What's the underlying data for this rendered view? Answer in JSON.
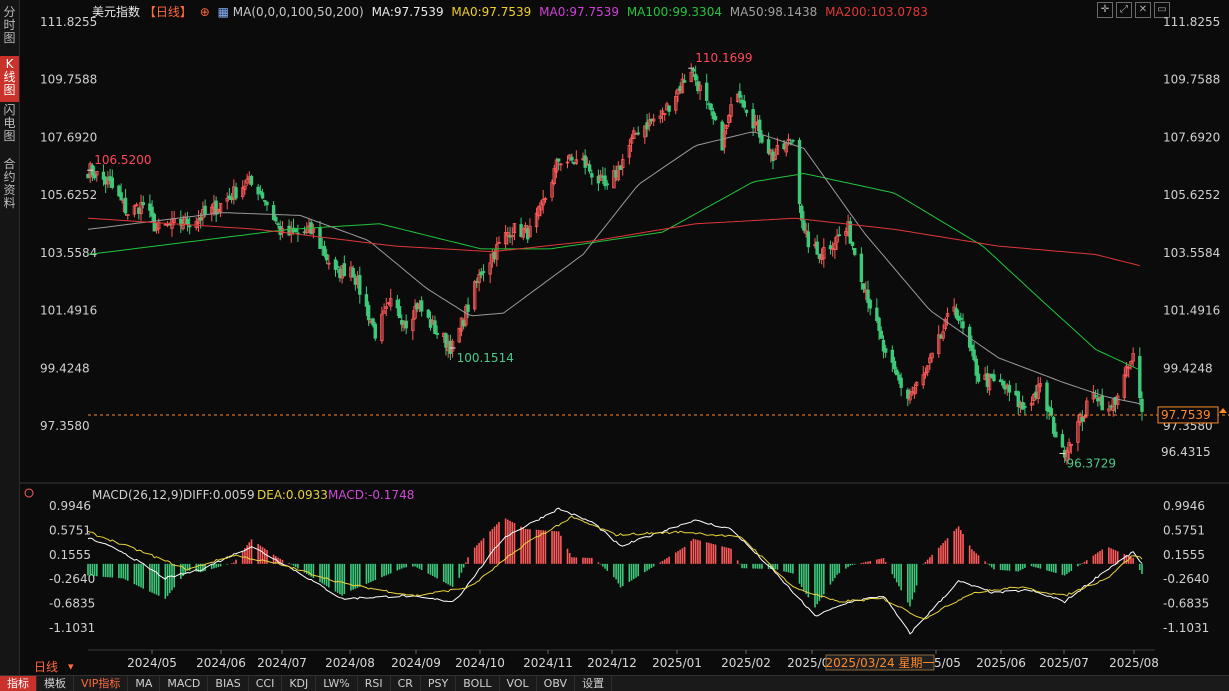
{
  "sidebar": {
    "tabs": [
      {
        "label": "分时图",
        "active": false
      },
      {
        "label": "K线图",
        "active": true
      },
      {
        "label": "闪电图",
        "active": false
      },
      {
        "label": "合约资料",
        "active": false
      }
    ]
  },
  "header": {
    "title": "美元指数",
    "period": "【日线】",
    "ma_params": "MA(0,0,0,100,50,200)",
    "ma_close": "MA:97.7539",
    "ma1": "MA0:97.7539",
    "ma2": "MA0:97.7539",
    "ma100": "MA100:99.3304",
    "ma50": "MA50:98.1438",
    "ma200": "MA200:103.0783",
    "icons": [
      "crosshair-icon",
      "expand-icon",
      "close-icon",
      "window-icon"
    ]
  },
  "colors": {
    "up": "#ff5a5a",
    "down": "#3ec97a",
    "ma50": "#9a9a9a",
    "ma100": "#22c53c",
    "ma200": "#e03838",
    "label_high": "#ff4a5a",
    "label_low": "#4ec98a",
    "price": "#ff8a2a",
    "dif": "#ffffff",
    "dea": "#e8d23c",
    "macd": "#d048d8"
  },
  "price_labels": {
    "y_ticks_text": [
      "111.8255",
      "109.7588",
      "107.6920",
      "105.6252",
      "103.5584",
      "101.4916",
      "99.4248",
      "97.3580"
    ],
    "current": "97.7539",
    "low_right": "96.4315",
    "annot_high1": "106.5200",
    "annot_high2": "110.1699",
    "annot_low1": "100.1514",
    "annot_low2": "96.3729"
  },
  "macd_header": {
    "params": "MACD(26,12,9)",
    "diff": "DIFF:0.0059",
    "dea": "DEA:0.0933",
    "macd": "MACD:-0.1748"
  },
  "macd_ticks_text": [
    "0.9946",
    "0.5751",
    "0.1555",
    "-0.2640",
    "-0.6835",
    "-1.1031"
  ],
  "x_labels": [
    "2024/05",
    "2024/06",
    "2024/07",
    "2024/08",
    "2024/09",
    "2024/10",
    "2024/11",
    "2024/12",
    "2025/01",
    "2025/02",
    "2025/03",
    "2025/05",
    "2025/06",
    "2025/07",
    "2025/08"
  ],
  "cursor_date": "2025/03/24 星期一",
  "period_label": "日线",
  "toolbar": [
    "指标",
    "模板",
    "VIP指标",
    "MA",
    "MACD",
    "BIAS",
    "CCI",
    "KDJ",
    "LW%",
    "RSI",
    "CR",
    "PSY",
    "BOLL",
    "VOL",
    "OBV",
    "设置"
  ],
  "chart_data": {
    "type": "candlestick",
    "title": "美元指数",
    "ylim": [
      96.0,
      112.0
    ],
    "x_range": [
      "2024-04-15",
      "2025-08-05"
    ],
    "anchors": [
      [
        "2024-04-16",
        106.52
      ],
      [
        "2024-04-25",
        106.0
      ],
      [
        "2024-05-03",
        105.0
      ],
      [
        "2024-05-10",
        105.3
      ],
      [
        "2024-05-16",
        104.4
      ],
      [
        "2024-05-31",
        104.7
      ],
      [
        "2024-06-07",
        104.9
      ],
      [
        "2024-06-14",
        105.3
      ],
      [
        "2024-06-26",
        106.1
      ],
      [
        "2024-07-02",
        105.8
      ],
      [
        "2024-07-12",
        104.2
      ],
      [
        "2024-07-26",
        104.3
      ],
      [
        "2024-08-05",
        102.8
      ],
      [
        "2024-08-12",
        103.1
      ],
      [
        "2024-08-23",
        100.7
      ],
      [
        "2024-08-30",
        101.7
      ],
      [
        "2024-09-06",
        101.1
      ],
      [
        "2024-09-11",
        101.7
      ],
      [
        "2024-09-20",
        100.7
      ],
      [
        "2024-09-27",
        100.15
      ],
      [
        "2024-10-10",
        102.9
      ],
      [
        "2024-10-23",
        104.4
      ],
      [
        "2024-11-01",
        104.3
      ],
      [
        "2024-11-06",
        105.1
      ],
      [
        "2024-11-14",
        106.9
      ],
      [
        "2024-11-25",
        106.8
      ],
      [
        "2024-12-06",
        105.8
      ],
      [
        "2024-12-20",
        108.0
      ],
      [
        "2024-12-31",
        108.5
      ],
      [
        "2025-01-13",
        110.17
      ],
      [
        "2025-01-27",
        107.5
      ],
      [
        "2025-02-03",
        109.5
      ],
      [
        "2025-02-10",
        108.3
      ],
      [
        "2025-02-19",
        107.0
      ],
      [
        "2025-02-28",
        107.6
      ],
      [
        "2025-03-05",
        104.2
      ],
      [
        "2025-03-11",
        103.5
      ],
      [
        "2025-03-25",
        104.4
      ],
      [
        "2025-04-03",
        102.0
      ],
      [
        "2025-04-11",
        99.8
      ],
      [
        "2025-04-21",
        98.4
      ],
      [
        "2025-04-29",
        99.2
      ],
      [
        "2025-05-12",
        101.7
      ],
      [
        "2025-05-23",
        99.1
      ],
      [
        "2025-06-03",
        98.8
      ],
      [
        "2025-06-12",
        98.0
      ],
      [
        "2025-06-20",
        98.7
      ],
      [
        "2025-06-30",
        96.37
      ],
      [
        "2025-07-15",
        98.6
      ],
      [
        "2025-07-21",
        97.8
      ],
      [
        "2025-08-01",
        99.8
      ],
      [
        "2025-08-05",
        97.75
      ]
    ],
    "series": [
      {
        "name": "MA100",
        "values": [
          [
            "2024-04-15",
            103.5
          ],
          [
            "2024-07-15",
            104.4
          ],
          [
            "2024-08-25",
            104.6
          ],
          [
            "2024-10-10",
            103.7
          ],
          [
            "2024-11-10",
            103.7
          ],
          [
            "2024-12-31",
            104.3
          ],
          [
            "2025-02-10",
            106.1
          ],
          [
            "2025-03-05",
            106.4
          ],
          [
            "2025-04-15",
            105.7
          ],
          [
            "2025-05-25",
            103.8
          ],
          [
            "2025-06-20",
            101.9
          ],
          [
            "2025-07-15",
            100.1
          ],
          [
            "2025-08-05",
            99.33
          ]
        ]
      },
      {
        "name": "MA50",
        "values": [
          [
            "2024-04-15",
            104.4
          ],
          [
            "2024-06-15",
            105.0
          ],
          [
            "2024-07-20",
            104.9
          ],
          [
            "2024-08-20",
            104.0
          ],
          [
            "2024-09-15",
            102.3
          ],
          [
            "2024-10-05",
            101.3
          ],
          [
            "2024-10-20",
            101.4
          ],
          [
            "2024-11-25",
            103.5
          ],
          [
            "2024-12-20",
            106.0
          ],
          [
            "2025-01-15",
            107.4
          ],
          [
            "2025-02-10",
            107.9
          ],
          [
            "2025-03-05",
            107.3
          ],
          [
            "2025-04-01",
            104.3
          ],
          [
            "2025-05-01",
            101.5
          ],
          [
            "2025-06-01",
            99.8
          ],
          [
            "2025-07-01",
            98.9
          ],
          [
            "2025-07-20",
            98.4
          ],
          [
            "2025-08-05",
            98.14
          ]
        ]
      },
      {
        "name": "MA200",
        "values": [
          [
            "2024-04-15",
            104.8
          ],
          [
            "2024-07-01",
            104.4
          ],
          [
            "2024-09-01",
            103.8
          ],
          [
            "2024-10-15",
            103.6
          ],
          [
            "2024-12-01",
            104.0
          ],
          [
            "2025-01-15",
            104.6
          ],
          [
            "2025-03-01",
            104.8
          ],
          [
            "2025-04-15",
            104.4
          ],
          [
            "2025-06-01",
            103.8
          ],
          [
            "2025-07-15",
            103.5
          ],
          [
            "2025-08-05",
            103.08
          ]
        ]
      }
    ],
    "annotations": [
      {
        "date": "2024-04-16",
        "value": 106.52,
        "text": "106.5200"
      },
      {
        "date": "2025-01-13",
        "value": 110.1699,
        "text": "110.1699"
      },
      {
        "date": "2024-09-27",
        "value": 100.1514,
        "text": "100.1514"
      },
      {
        "date": "2025-06-30",
        "value": 96.3729,
        "text": "96.3729"
      }
    ],
    "current_price": 97.7539,
    "macd": {
      "params": "26,12,9",
      "diff": 0.0059,
      "dea": 0.0933,
      "macd": -0.1748,
      "ylim": [
        -1.3,
        1.15
      ],
      "dif_anchors": [
        [
          "2024-04-15",
          0.45
        ],
        [
          "2024-05-01",
          0.2
        ],
        [
          "2024-05-20",
          -0.25
        ],
        [
          "2024-06-05",
          -0.1
        ],
        [
          "2024-06-28",
          0.3
        ],
        [
          "2024-07-15",
          -0.05
        ],
        [
          "2024-08-08",
          -0.6
        ],
        [
          "2024-09-05",
          -0.55
        ],
        [
          "2024-09-28",
          -0.65
        ],
        [
          "2024-10-20",
          0.45
        ],
        [
          "2024-11-14",
          0.95
        ],
        [
          "2024-11-30",
          0.7
        ],
        [
          "2024-12-12",
          0.3
        ],
        [
          "2025-01-14",
          0.75
        ],
        [
          "2025-01-31",
          0.6
        ],
        [
          "2025-02-20",
          -0.15
        ],
        [
          "2025-03-10",
          -0.9
        ],
        [
          "2025-03-26",
          -0.65
        ],
        [
          "2025-04-10",
          -0.55
        ],
        [
          "2025-04-22",
          -1.2
        ],
        [
          "2025-05-14",
          -0.3
        ],
        [
          "2025-05-30",
          -0.5
        ],
        [
          "2025-06-15",
          -0.45
        ],
        [
          "2025-07-01",
          -0.65
        ],
        [
          "2025-07-20",
          -0.1
        ],
        [
          "2025-08-01",
          0.2
        ],
        [
          "2025-08-05",
          0.0059
        ]
      ],
      "dea_anchors": [
        [
          "2024-04-15",
          0.55
        ],
        [
          "2024-05-10",
          0.2
        ],
        [
          "2024-05-30",
          -0.1
        ],
        [
          "2024-06-20",
          0.15
        ],
        [
          "2024-07-10",
          0.0
        ],
        [
          "2024-08-10",
          -0.35
        ],
        [
          "2024-09-10",
          -0.55
        ],
        [
          "2024-10-05",
          -0.4
        ],
        [
          "2024-10-30",
          0.35
        ],
        [
          "2024-11-20",
          0.8
        ],
        [
          "2024-12-10",
          0.5
        ],
        [
          "2025-01-10",
          0.55
        ],
        [
          "2025-02-05",
          0.45
        ],
        [
          "2025-02-28",
          -0.4
        ],
        [
          "2025-03-20",
          -0.65
        ],
        [
          "2025-04-10",
          -0.6
        ],
        [
          "2025-04-28",
          -0.95
        ],
        [
          "2025-05-20",
          -0.5
        ],
        [
          "2025-06-10",
          -0.4
        ],
        [
          "2025-07-01",
          -0.55
        ],
        [
          "2025-07-20",
          -0.25
        ],
        [
          "2025-08-01",
          0.15
        ],
        [
          "2025-08-05",
          0.0933
        ]
      ]
    }
  }
}
